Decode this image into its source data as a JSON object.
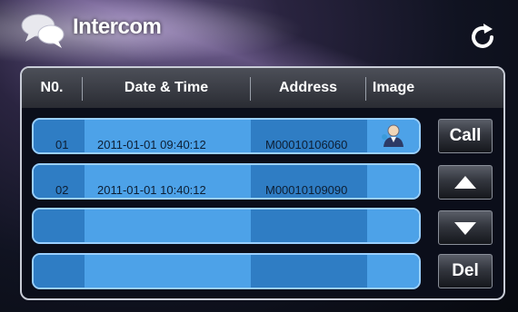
{
  "header": {
    "title": "Intercom",
    "chat_icon": "chat-bubbles-icon",
    "refresh_icon": "refresh-icon"
  },
  "table": {
    "columns": [
      "N0.",
      "Date & Time",
      "Address",
      "Image"
    ],
    "rows": [
      {
        "no": "01",
        "datetime": "2011-01-01 09:40:12",
        "address": "M00010106060",
        "image": "user-avatar-icon"
      },
      {
        "no": "02",
        "datetime": "2011-01-01 10:40:12",
        "address": "M00010109090",
        "image": ""
      },
      {
        "no": "",
        "datetime": "",
        "address": "",
        "image": ""
      },
      {
        "no": "",
        "datetime": "",
        "address": "",
        "image": ""
      }
    ]
  },
  "buttons": {
    "call": "Call",
    "up_icon": "arrow-up-icon",
    "down_icon": "arrow-down-icon",
    "del": "Del"
  },
  "colors": {
    "row_blue": "#3a8ed6",
    "row_border": "#9ad0ff",
    "header_bg": "#3b3e46"
  }
}
